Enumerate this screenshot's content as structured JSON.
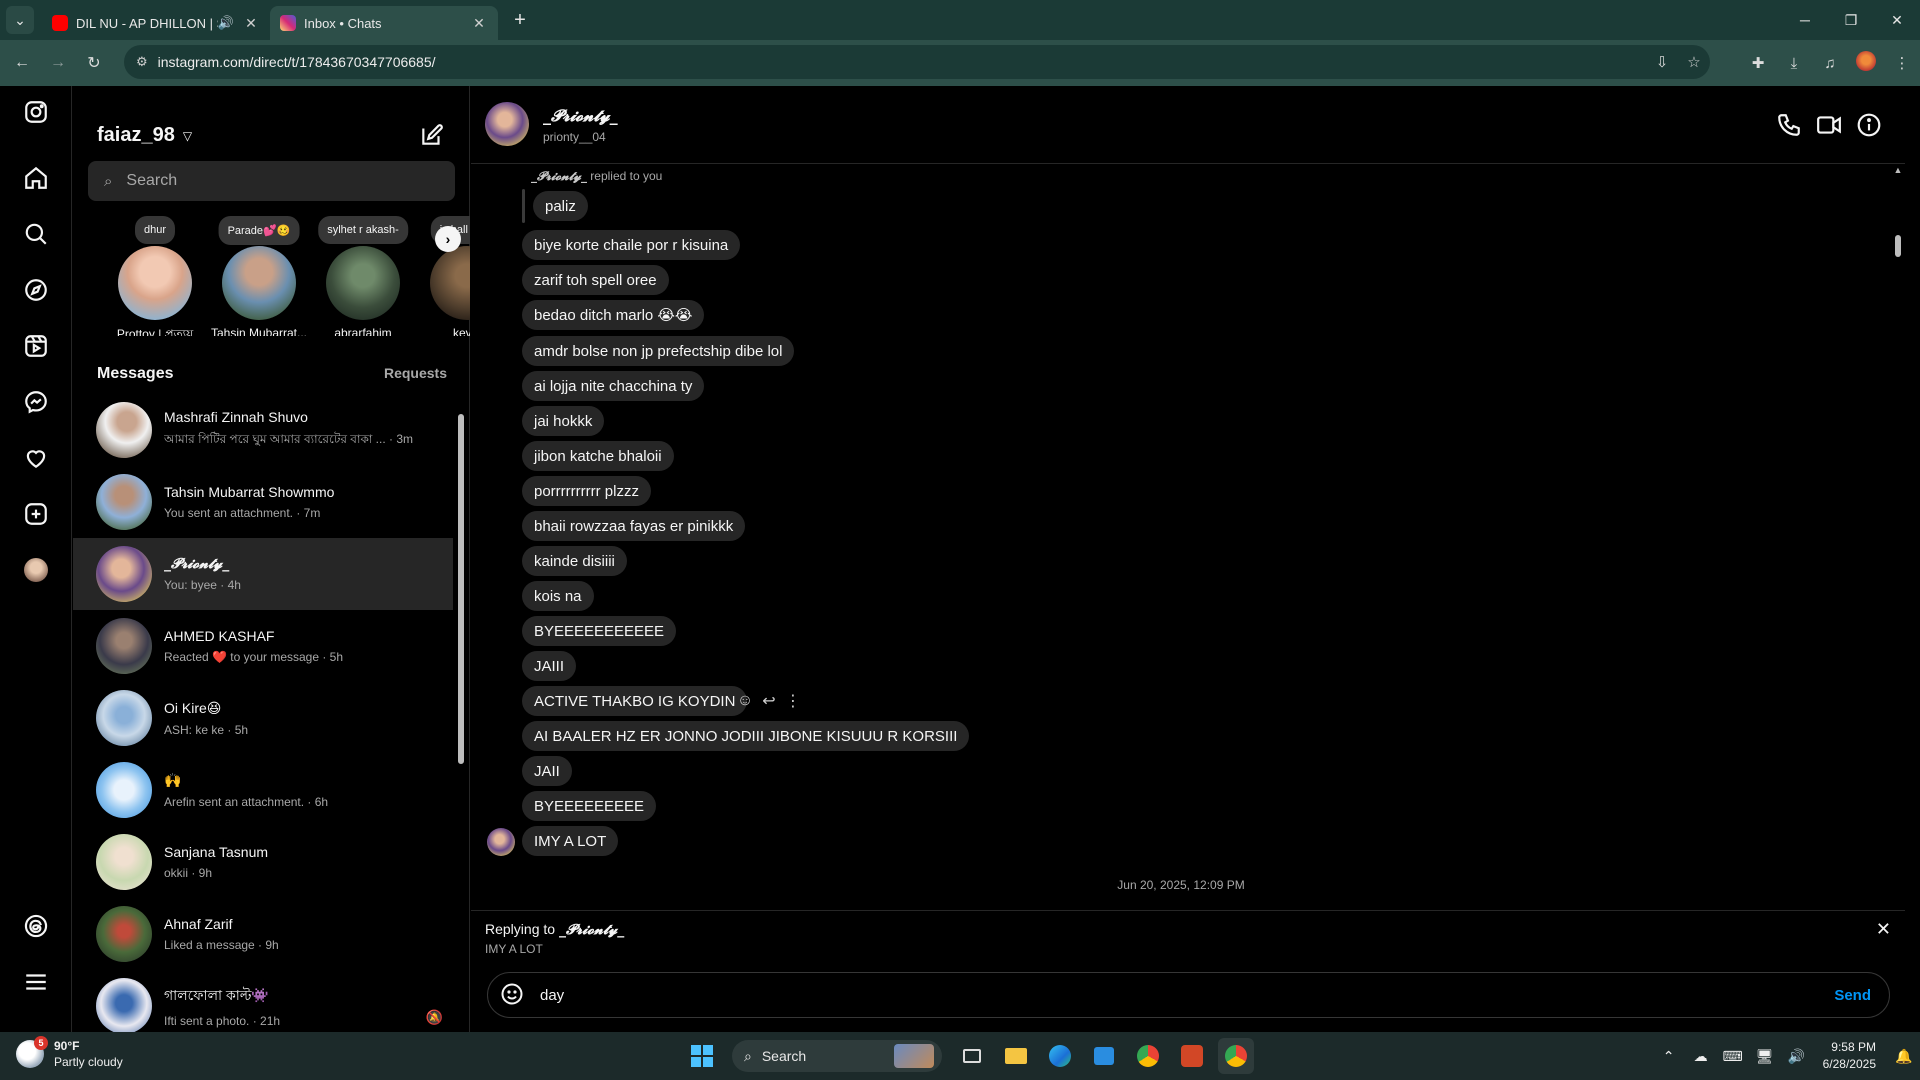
{
  "browser": {
    "tabs": [
      {
        "title": "DIL NU - AP DHILLON | SHI",
        "favicon_color": "#ff0000",
        "audio": true,
        "active": false
      },
      {
        "title": "Inbox • Chats",
        "favicon_color": "#d6249f",
        "audio": false,
        "active": true
      }
    ],
    "url": "instagram.com/direct/t/17843670347706685/"
  },
  "inbox": {
    "username": "faiaz_98",
    "search_placeholder": "Search",
    "notes": [
      {
        "bubble": "dhur",
        "name": "Prottoy | প্রত্যয়"
      },
      {
        "bubble": "Parade💕🥴",
        "name": "Tahsin Mubarrat..."
      },
      {
        "bubble": "sylhet r akash-",
        "name": "abrarfahim"
      },
      {
        "bubble": "i shall pass",
        "name": "kevin"
      }
    ],
    "messages_label": "Messages",
    "requests_label": "Requests",
    "threads": [
      {
        "name": "Mashrafi Zinnah Shuvo",
        "preview": "আমার পিটির পরে ঘুম আমার ব্যারেটের বাকা ... · 3m"
      },
      {
        "name": "Tahsin Mubarrat Showmmo",
        "preview": "You sent an attachment. · 7m"
      },
      {
        "name": "_𝓟𝓻𝓲𝓸𝓷𝓽𝔂_",
        "preview": "You: byee · 4h",
        "selected": true
      },
      {
        "name": "AHMED KASHAF",
        "preview": "Reacted ❤️ to your message · 5h"
      },
      {
        "name": "Oi Kire😆",
        "preview": "ASH: ke ke · 5h"
      },
      {
        "name": "🙌",
        "preview": "Arefin sent an attachment. · 6h"
      },
      {
        "name": "Sanjana Tasnum",
        "preview": "okkii · 9h"
      },
      {
        "name": "Ahnaf Zarif",
        "preview": "Liked a message · 9h"
      },
      {
        "name": "গালফোলা কাল্ট👾",
        "preview": "Ifti sent a photo. · 21h"
      }
    ]
  },
  "chat": {
    "display_name": "_𝓟𝓻𝓲𝓸𝓷𝓽𝔂_",
    "username": "prionty__04",
    "reply_note_name": "_𝓟𝓻𝓲𝓸𝓷𝓽𝔂_",
    "reply_note_text": "replied to you",
    "quoted": "paliz",
    "messages": [
      "biye korte chaile por r kisuina",
      "zarif toh spell oree",
      "bedao ditch marlo 😭😭",
      "amdr bolse non jp prefectship dibe lol",
      "ai lojja nite chacchina ty",
      "jai hokkk",
      "jibon katche bhaloii",
      "porrrrrrrrrr plzzz",
      "bhaii rowzzaa fayas er pinikkk",
      "kainde disiiii",
      "kois na",
      "BYEEEEEEEEEEE",
      "JAIII",
      "ACTIVE THAKBO IG KOYDIN",
      "AI BAALER HZ ER JONNO JODIII JIBONE KISUUU R KORSIII",
      "JAII",
      "BYEEEEEEEEE",
      "IMY A LOT"
    ],
    "timestamp": "Jun 20, 2025, 12:09 PM",
    "replying_label": "Replying to",
    "replying_name": "_𝓟𝓻𝓲𝓸𝓷𝓽𝔂_",
    "replying_text": "IMY A LOT",
    "composer_value": "day",
    "send_label": "Send",
    "accent": "#0095f6"
  },
  "taskbar": {
    "temp": "90°F",
    "condition": "Partly cloudy",
    "badge": "5",
    "search_label": "Search",
    "time": "9:58 PM",
    "date": "6/28/2025"
  }
}
